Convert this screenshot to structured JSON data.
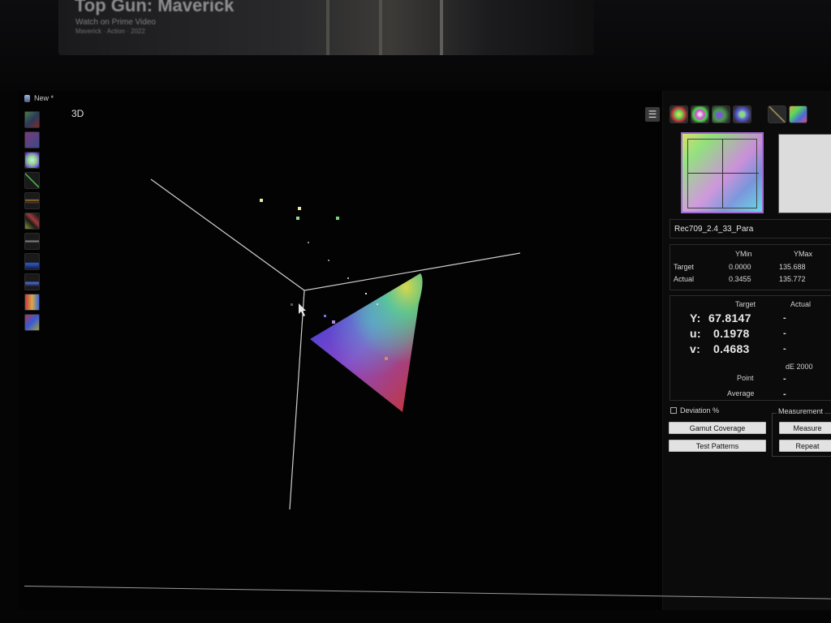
{
  "background": {
    "title": "Top Gun: Maverick",
    "subtitle": "Watch on Prime Video",
    "detail": "Maverick · Action · 2022"
  },
  "window": {
    "title": "New *",
    "view_label": "3D",
    "left_tools": [
      {
        "icon": "cie-diagram-icon",
        "color": "#4a7a4a"
      },
      {
        "icon": "gamut-triangle-icon",
        "color": "#7a3a7a"
      },
      {
        "icon": "color-wheel-icon",
        "color": "#b0b0b0"
      },
      {
        "icon": "gamma-curve-icon",
        "color": "#3a6a3a"
      },
      {
        "icon": "rgb-balance-icon",
        "color": "#6a5a2a"
      },
      {
        "icon": "luminance-icon",
        "color": "#6a7a2a"
      },
      {
        "icon": "grayscale-icon",
        "color": "#5a5a5a"
      },
      {
        "icon": "waveform-icon",
        "color": "#2a3a6a"
      },
      {
        "icon": "spectrum-icon",
        "color": "#3a4a7a"
      },
      {
        "icon": "delta-e-icon",
        "color": "#7a3a3a"
      },
      {
        "icon": "histogram-icon",
        "color": "#6a4a5a"
      }
    ]
  },
  "panel": {
    "menu_icon": "hamburger-menu-icon",
    "view_icons": [
      "cie-xy-view-icon",
      "cie-uv-view-icon",
      "cie-3d-view-icon",
      "gamut-view-icon",
      "target-view-icon",
      "color-grid-icon"
    ],
    "pattern_name": "Rec709_2.4_33_Para",
    "ytable": {
      "col_min": "YMin",
      "col_max": "YMax",
      "rows": [
        {
          "label": "Target",
          "min": "0.0000",
          "max": "135.688"
        },
        {
          "label": "Actual",
          "min": "0.3455",
          "max": "135.772"
        }
      ]
    },
    "measure": {
      "col_target": "Target",
      "col_actual": "Actual",
      "rows": [
        {
          "label": "Y:",
          "target": "67.8147",
          "actual": "-"
        },
        {
          "label": "u:",
          "target": "0.1978",
          "actual": "-"
        },
        {
          "label": "v:",
          "target": "0.4683",
          "actual": "-"
        }
      ],
      "de_header": "dE 2000",
      "point_label": "Point",
      "point_value": "-",
      "average_label": "Average",
      "average_value": "-"
    },
    "deviation_label": "Deviation %",
    "gamut_button": "Gamut Coverage",
    "patterns_button": "Test Patterns",
    "measurement_group": "Measurement",
    "measure_button": "Measure",
    "repeat_button": "Repeat",
    "colors": {
      "swatch_border": "#a06ad0",
      "grey_swatch": "#dcdcdc"
    }
  }
}
